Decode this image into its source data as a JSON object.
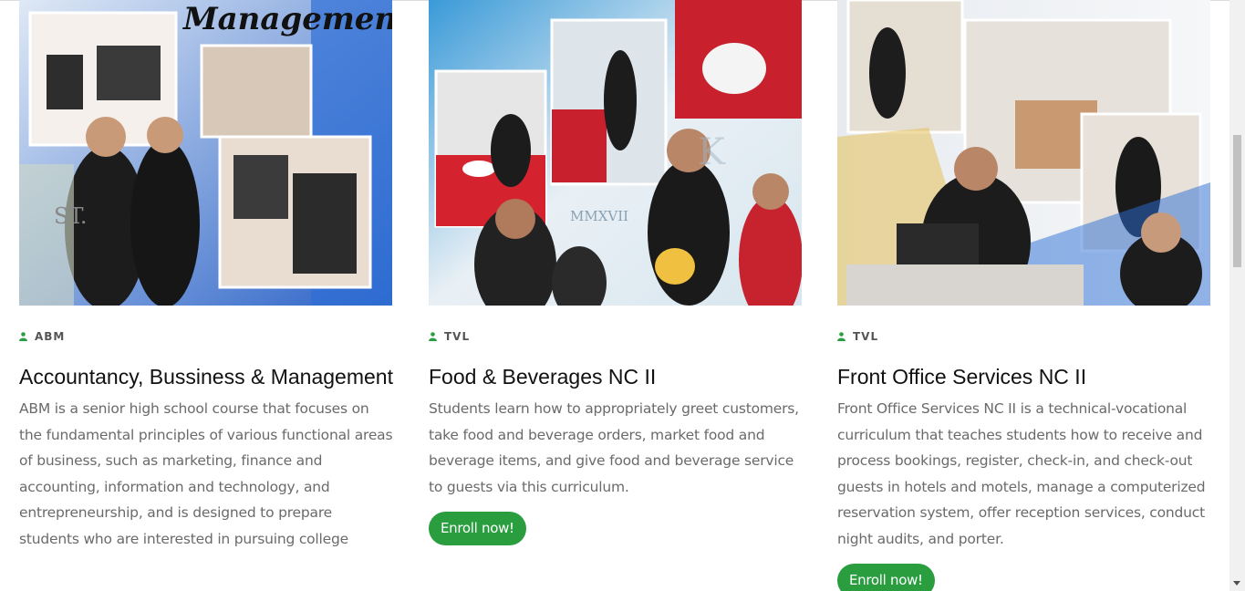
{
  "cards": [
    {
      "image_heading": "Management",
      "image_text_1": "ST.",
      "category": "ABM",
      "title": "Accountancy, Bussiness & Management",
      "description": "ABM is a senior high school course that focuses on the fundamental principles of various functional areas of business, such as marketing, finance and accounting, information and technology, and entrepreneurship, and is designed to prepare students who are interested in pursuing college",
      "enroll_label": ""
    },
    {
      "image_text_1": "MMXVII",
      "image_text_2": "K",
      "category": "TVL",
      "title": "Food & Beverages NC II",
      "description": "Students learn how to appropriately greet customers, take food and beverage orders, market food and beverage items, and give food and beverage service to guests via this curriculum.",
      "enroll_label": "Enroll now!"
    },
    {
      "category": "TVL",
      "title": "Front Office Services NC II",
      "description": "Front Office Services NC II is a technical-vocational curriculum that teaches students how to receive and process bookings, register, check-in, and check-out guests in hotels and motels, manage a computerized reservation system, offer reception services, conduct night audits, and porter.",
      "enroll_label": "Enroll now!"
    }
  ],
  "colors": {
    "accent": "#2a9d3f",
    "title": "#111111",
    "text": "#6a6a6a",
    "category": "#555555"
  },
  "icons": {
    "category_icon": "user-icon"
  }
}
